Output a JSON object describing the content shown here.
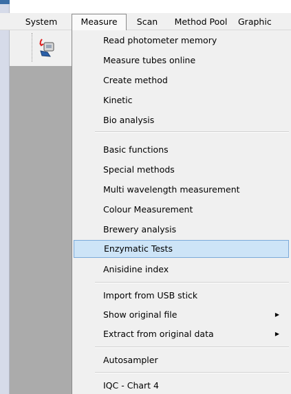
{
  "menubar": {
    "items": [
      "System",
      "Measure",
      "Scan",
      "Method Pool",
      "Graphic"
    ]
  },
  "dropdown": {
    "groups": [
      [
        "Read photometer memory",
        "Measure tubes online",
        "Create method",
        "Kinetic",
        "Bio analysis"
      ],
      [
        "Basic functions",
        "Special methods",
        "Multi wavelength measurement",
        "Colour Measurement",
        "Brewery analysis",
        "Enzymatic Tests",
        "Anisidine index"
      ],
      [
        "Import from USB stick",
        "Show original file",
        "Extract from original data"
      ],
      [
        "Autosampler"
      ],
      [
        "IQC - Chart 4"
      ]
    ],
    "highlighted": "Enzymatic Tests"
  },
  "icons": {
    "submenu_arrow": "submenu-arrow-icon",
    "toolbar": "photometer-read-icon"
  }
}
